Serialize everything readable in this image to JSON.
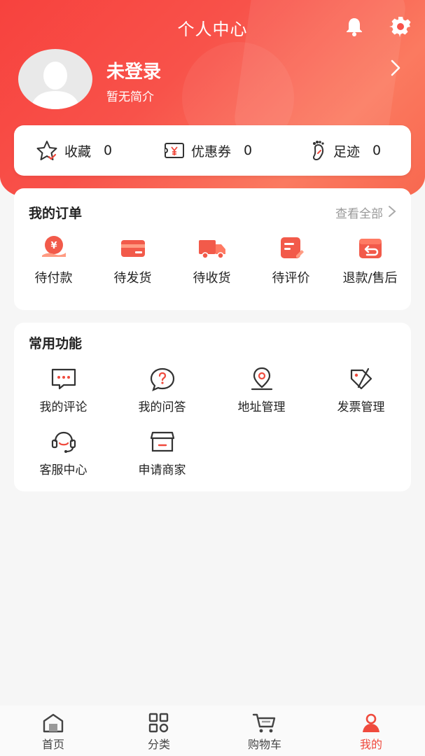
{
  "header": {
    "title": "个人中心",
    "bell_icon": "bell-icon",
    "settings_icon": "gear-icon"
  },
  "profile": {
    "name": "未登录",
    "intro": "暂无简介"
  },
  "stats": [
    {
      "label": "收藏",
      "value": "0",
      "icon": "star-icon"
    },
    {
      "label": "优惠券",
      "value": "0",
      "icon": "coupon-icon"
    },
    {
      "label": "足迹",
      "value": "0",
      "icon": "footprint-icon"
    }
  ],
  "orders": {
    "title": "我的订单",
    "view_all": "查看全部",
    "items": [
      {
        "label": "待付款",
        "icon": "payment-icon"
      },
      {
        "label": "待发货",
        "icon": "card-icon"
      },
      {
        "label": "待收货",
        "icon": "truck-icon"
      },
      {
        "label": "待评价",
        "icon": "review-icon"
      },
      {
        "label": "退款/售后",
        "icon": "refund-icon"
      }
    ]
  },
  "functions": {
    "title": "常用功能",
    "items": [
      {
        "label": "我的评论",
        "icon": "comment-icon"
      },
      {
        "label": "我的问答",
        "icon": "question-icon"
      },
      {
        "label": "地址管理",
        "icon": "location-icon"
      },
      {
        "label": "发票管理",
        "icon": "invoice-icon"
      },
      {
        "label": "客服中心",
        "icon": "headset-icon"
      },
      {
        "label": "申请商家",
        "icon": "store-icon"
      }
    ]
  },
  "tabbar": [
    {
      "label": "首页",
      "icon": "home-icon"
    },
    {
      "label": "分类",
      "icon": "category-icon"
    },
    {
      "label": "购物车",
      "icon": "cart-icon"
    },
    {
      "label": "我的",
      "icon": "user-icon",
      "active": true
    }
  ],
  "colors": {
    "accent": "#ef4a3d",
    "header_gradient_start": "#f7423e",
    "header_gradient_end": "#fb7a60"
  }
}
